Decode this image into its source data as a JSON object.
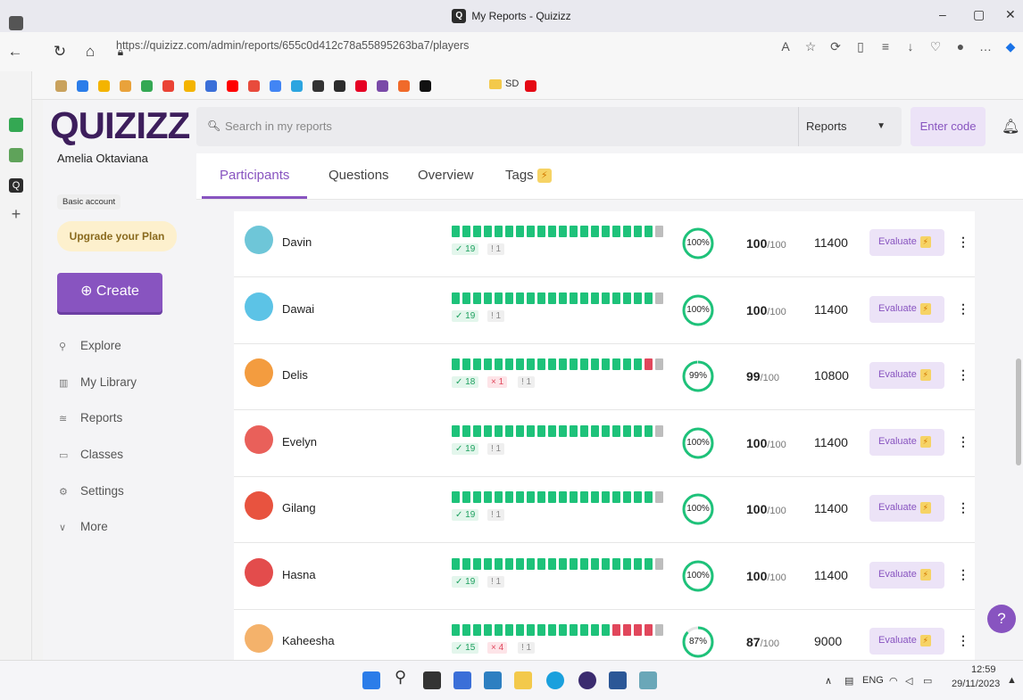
{
  "window": {
    "title": "My Reports - Quizizz",
    "controls": [
      "–",
      "▢",
      "✕"
    ]
  },
  "browser": {
    "url": "https://quizizz.com/admin/reports/655c0d412c78a55895263ba7/players",
    "bookmark_folder": "SD"
  },
  "sidebar": {
    "logo": "QUIZIZZ",
    "user_name": "Amelia Oktaviana",
    "account_type": "Basic account",
    "upgrade_label": "Upgrade your Plan",
    "create_label": "⊕ Create",
    "nav": [
      {
        "label": "Explore",
        "icon": "explore-icon"
      },
      {
        "label": "My Library",
        "icon": "library-icon"
      },
      {
        "label": "Reports",
        "icon": "reports-icon"
      },
      {
        "label": "Classes",
        "icon": "classes-icon"
      },
      {
        "label": "Settings",
        "icon": "settings-icon"
      },
      {
        "label": "More",
        "icon": "chevron-down-icon"
      }
    ]
  },
  "header": {
    "search_placeholder": "Search in my reports",
    "dropdown_value": "Reports",
    "enter_code_label": "Enter code"
  },
  "tabs": [
    {
      "label": "Participants",
      "active": true
    },
    {
      "label": "Questions",
      "active": false
    },
    {
      "label": "Overview",
      "active": false
    },
    {
      "label": "Tags",
      "active": false
    }
  ],
  "participants": [
    {
      "name": "Davin",
      "correct": 19,
      "wrong": 0,
      "skipped": 1,
      "accuracy": "100%",
      "accuracy_value": 100,
      "score": "100",
      "max": "/100",
      "points": "11400",
      "avatar_color": "#6ec6d8"
    },
    {
      "name": "Dawai",
      "correct": 19,
      "wrong": 0,
      "skipped": 1,
      "accuracy": "100%",
      "accuracy_value": 100,
      "score": "100",
      "max": "/100",
      "points": "11400",
      "avatar_color": "#5cc3e6"
    },
    {
      "name": "Delis",
      "correct": 18,
      "wrong": 1,
      "skipped": 1,
      "accuracy": "99%",
      "accuracy_value": 99,
      "score": "99",
      "max": "/100",
      "points": "10800",
      "avatar_color": "#f39c3f"
    },
    {
      "name": "Evelyn",
      "correct": 19,
      "wrong": 0,
      "skipped": 1,
      "accuracy": "100%",
      "accuracy_value": 100,
      "score": "100",
      "max": "/100",
      "points": "11400",
      "avatar_color": "#e9605a"
    },
    {
      "name": "Gilang",
      "correct": 19,
      "wrong": 0,
      "skipped": 1,
      "accuracy": "100%",
      "accuracy_value": 100,
      "score": "100",
      "max": "/100",
      "points": "11400",
      "avatar_color": "#e8533f"
    },
    {
      "name": "Hasna",
      "correct": 19,
      "wrong": 0,
      "skipped": 1,
      "accuracy": "100%",
      "accuracy_value": 100,
      "score": "100",
      "max": "/100",
      "points": "11400",
      "avatar_color": "#e34c4c"
    },
    {
      "name": "Kaheesha",
      "correct": 15,
      "wrong": 4,
      "skipped": 1,
      "accuracy": "87%",
      "accuracy_value": 87,
      "score": "87",
      "max": "/100",
      "points": "9000",
      "avatar_color": "#f4b26b"
    }
  ],
  "labels": {
    "evaluate": "Evaluate",
    "help": "?"
  },
  "colors": {
    "accent": "#8854c0",
    "correct": "#1ec27a",
    "wrong": "#e1475c",
    "skipped": "#bdbdbd",
    "ring": "#1ec27a"
  },
  "taskbar": {
    "lang": "ENG",
    "time": "12:59",
    "date": "29/11/2023"
  }
}
